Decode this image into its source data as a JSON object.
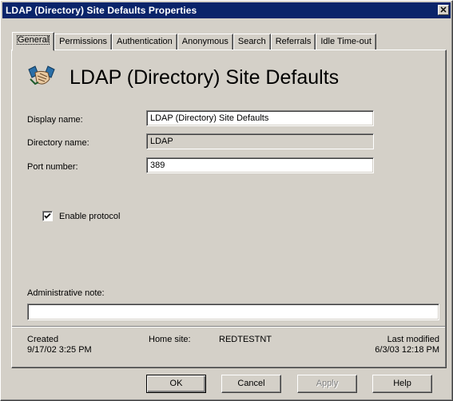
{
  "window": {
    "title": "LDAP (Directory) Site Defaults Properties",
    "close_glyph": "✕"
  },
  "tabs": [
    {
      "label": "General",
      "active": true
    },
    {
      "label": "Permissions"
    },
    {
      "label": "Authentication"
    },
    {
      "label": "Anonymous"
    },
    {
      "label": "Search"
    },
    {
      "label": "Referrals"
    },
    {
      "label": "Idle Time-out"
    }
  ],
  "header": {
    "title": "LDAP (Directory) Site Defaults",
    "icon": "handshake-icon"
  },
  "fields": {
    "display_name": {
      "label": "Display name:",
      "value": "LDAP (Directory) Site Defaults"
    },
    "directory_name": {
      "label": "Directory name:",
      "value": "LDAP"
    },
    "port_number": {
      "label": "Port number:",
      "value": "389"
    }
  },
  "enable_protocol": {
    "label": "Enable protocol",
    "checked": true
  },
  "admin_note": {
    "label": "Administrative note:",
    "value": ""
  },
  "status": {
    "created_label": "Created",
    "created_value": "9/17/02  3:25 PM",
    "home_site_label": "Home site:",
    "home_site_value": "REDTESTNT",
    "modified_label": "Last modified",
    "modified_value": "6/3/03  12:18 PM"
  },
  "buttons": {
    "ok": "OK",
    "cancel": "Cancel",
    "apply": "Apply",
    "help": "Help"
  }
}
